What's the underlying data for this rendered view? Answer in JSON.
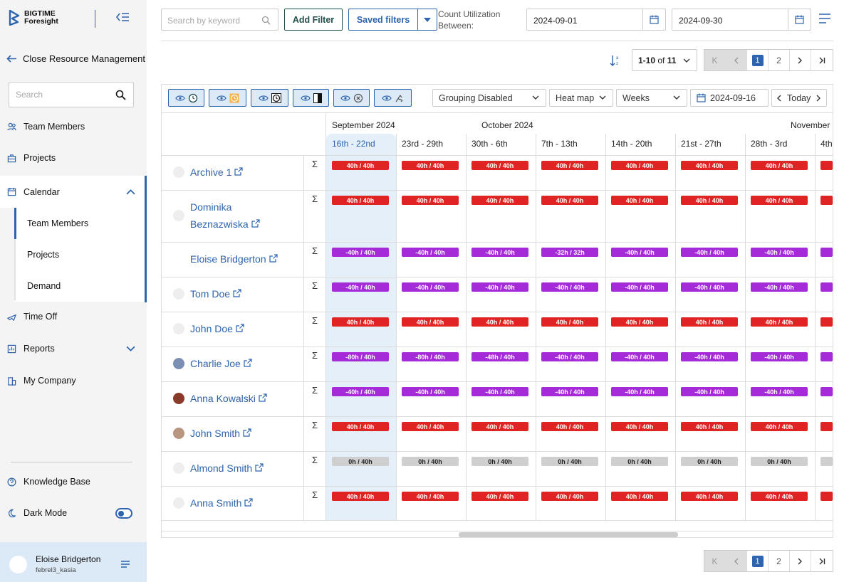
{
  "brand": {
    "line1": "BIGTIME",
    "line2": "Foresight"
  },
  "sidebar": {
    "back_label": "Close Resource Management",
    "search_placeholder": "Search",
    "items": {
      "team_members": "Team Members",
      "projects": "Projects",
      "calendar": "Calendar",
      "cal_team_members": "Team Members",
      "cal_projects": "Projects",
      "cal_demand": "Demand",
      "time_off": "Time Off",
      "reports": "Reports",
      "my_company": "My Company",
      "knowledge_base": "Knowledge Base",
      "dark_mode": "Dark Mode"
    },
    "dark_mode_on": true,
    "user": {
      "name": "Eloise Bridgerton",
      "login": "febrel3_kasia"
    }
  },
  "toolbar": {
    "search_placeholder": "Search by keyword",
    "add_filter": "Add Filter",
    "saved_filters": "Saved filters",
    "count_label_1": "Count Utilization",
    "count_label_2": "Between:",
    "date_from": "2024-09-01",
    "date_to": "2024-09-30"
  },
  "pagination": {
    "range": "1-10",
    "of": "of",
    "total": "11",
    "pages": [
      "1",
      "2"
    ],
    "current": "1"
  },
  "grid_controls": {
    "grouping": "Grouping Disabled",
    "view": "Heat map",
    "period": "Weeks",
    "date": "2024-09-16",
    "today": "Today"
  },
  "months": [
    "September 2024",
    "October 2024",
    "November"
  ],
  "weeks": [
    "16th - 22nd",
    "23rd - 29th",
    "30th - 6th",
    "7th - 13th",
    "14th - 20th",
    "21st - 27th",
    "28th - 3rd",
    "4th"
  ],
  "rows": [
    {
      "name": "Archive 1",
      "cells": [
        "40h / 40h",
        "40h / 40h",
        "40h / 40h",
        "40h / 40h",
        "40h / 40h",
        "40h / 40h",
        "40h / 40h"
      ],
      "color": "red"
    },
    {
      "name": "Dominika Beznazwiska",
      "name1": "Dominika",
      "name2": "Beznazwiska",
      "cells": [
        "40h / 40h",
        "40h / 40h",
        "40h / 40h",
        "40h / 40h",
        "40h / 40h",
        "40h / 40h",
        "40h / 40h"
      ],
      "color": "red"
    },
    {
      "name": "Eloise Bridgerton",
      "cells": [
        "-40h / 40h",
        "-40h / 40h",
        "-40h / 40h",
        "-32h / 32h",
        "-40h / 40h",
        "-40h / 40h",
        "-40h / 40h"
      ],
      "color": "pur"
    },
    {
      "name": "Tom Doe",
      "cells": [
        "-40h / 40h",
        "-40h / 40h",
        "-40h / 40h",
        "-40h / 40h",
        "-40h / 40h",
        "-40h / 40h",
        "-40h / 40h"
      ],
      "color": "pur"
    },
    {
      "name": "John Doe",
      "cells": [
        "40h / 40h",
        "40h / 40h",
        "40h / 40h",
        "40h / 40h",
        "40h / 40h",
        "40h / 40h",
        "40h / 40h"
      ],
      "color": "red"
    },
    {
      "name": "Charlie Joe",
      "cells": [
        "-80h / 40h",
        "-80h / 40h",
        "-48h / 40h",
        "-40h / 40h",
        "-40h / 40h",
        "-40h / 40h",
        "-40h / 40h"
      ],
      "color": "pur"
    },
    {
      "name": "Anna Kowalski",
      "cells": [
        "-40h / 40h",
        "-40h / 40h",
        "-40h / 40h",
        "-40h / 40h",
        "-40h / 40h",
        "-40h / 40h",
        "-40h / 40h"
      ],
      "color": "pur"
    },
    {
      "name": "John Smith",
      "cells": [
        "40h / 40h",
        "40h / 40h",
        "40h / 40h",
        "40h / 40h",
        "40h / 40h",
        "40h / 40h",
        "40h / 40h"
      ],
      "color": "red"
    },
    {
      "name": "Almond Smith",
      "cells": [
        "0h / 40h",
        "0h / 40h",
        "0h / 40h",
        "0h / 40h",
        "0h / 40h",
        "0h / 40h",
        "0h / 40h"
      ],
      "color": "gry"
    },
    {
      "name": "Anna Smith",
      "cells": [
        "40h / 40h",
        "40h / 40h",
        "40h / 40h",
        "40h / 40h",
        "40h / 40h",
        "40h / 40h",
        "40h / 40h"
      ],
      "color": "red"
    }
  ],
  "colors": {
    "accent": "#2d64ad",
    "over": "#e02424",
    "under": "#a52ad8",
    "none": "#cfcfcf"
  }
}
